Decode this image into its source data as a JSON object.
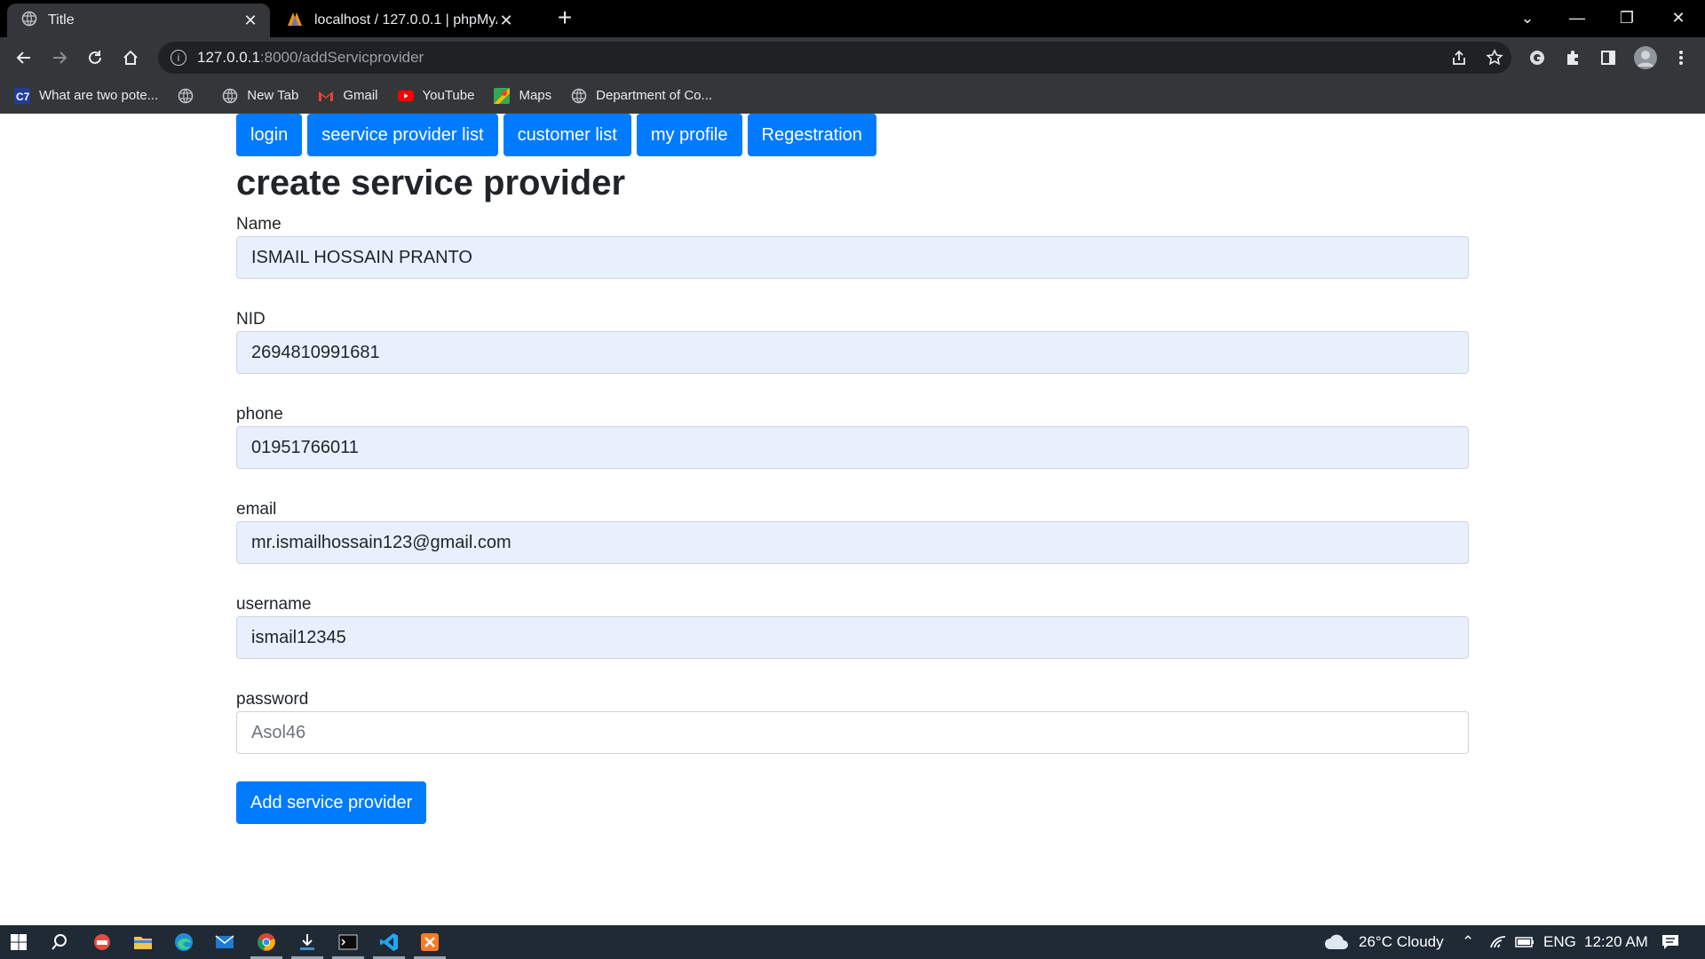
{
  "browser": {
    "tabs": [
      {
        "title": "Title",
        "active": true,
        "icon": "globe-icon"
      },
      {
        "title": "localhost / 127.0.0.1 | phpMyAdmin",
        "active": false,
        "icon": "phpmyadmin-icon"
      }
    ],
    "address": {
      "host": "127.0.0.1",
      "path": ":8000/addServicprovider"
    },
    "bookmarks": [
      {
        "label": "What are two pote...",
        "icon": "c7-icon"
      },
      {
        "label": "",
        "icon": "globe-icon"
      },
      {
        "label": "New Tab",
        "icon": "globe-icon"
      },
      {
        "label": "Gmail",
        "icon": "gmail-icon"
      },
      {
        "label": "YouTube",
        "icon": "youtube-icon"
      },
      {
        "label": "Maps",
        "icon": "maps-icon"
      },
      {
        "label": "Department of Co...",
        "icon": "globe-icon"
      }
    ]
  },
  "nav": {
    "login": "login",
    "provider_list": "seervice provider list",
    "customer_list": "customer list",
    "my_profile": "my profile",
    "registration": "Regestration"
  },
  "page": {
    "title": "create service provider"
  },
  "form": {
    "name": {
      "label": "Name",
      "value": "ISMAIL HOSSAIN PRANTO"
    },
    "nid": {
      "label": "NID",
      "value": "2694810991681"
    },
    "phone": {
      "label": "phone",
      "value": "01951766011"
    },
    "email": {
      "label": "email",
      "value": "mr.ismailhossain123@gmail.com"
    },
    "username": {
      "label": "username",
      "value": "ismail12345"
    },
    "password": {
      "label": "password",
      "value": "Asol46"
    },
    "submit": "Add service provider"
  },
  "taskbar": {
    "weather": "26°C  Cloudy",
    "language": "ENG",
    "time": "12:20 AM"
  },
  "colors": {
    "primary": "#007bff",
    "autofill": "#e8f0fe",
    "chrome_dark": "#35363a"
  }
}
